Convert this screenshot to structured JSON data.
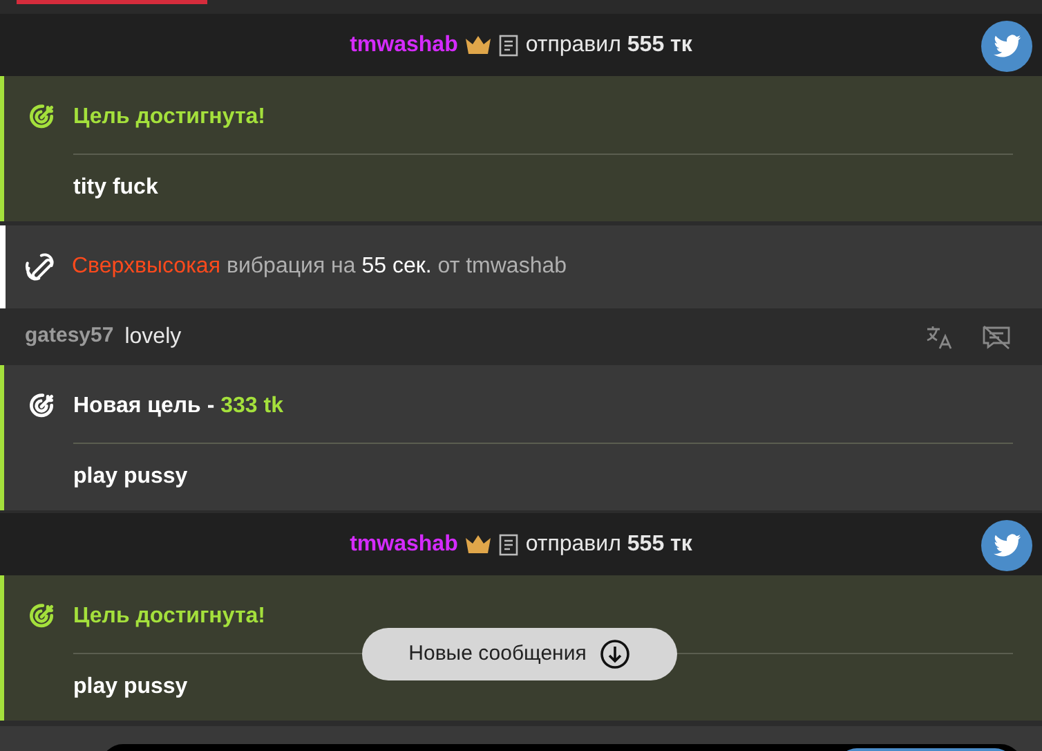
{
  "messages": [
    {
      "kind": "tip",
      "user": "tmwashab",
      "verb": "отправил",
      "amount": "555 тк"
    },
    {
      "kind": "goal_reached",
      "title": "Цель достигнута!",
      "text": "tity fuck"
    },
    {
      "kind": "vibration",
      "strength": "Сверхвысокая",
      "middle": "вибрация на",
      "duration": "55 сек.",
      "tail": "от tmwashab"
    },
    {
      "kind": "chat",
      "user": "gatesy57",
      "text": "lovely"
    },
    {
      "kind": "new_goal",
      "title": "Новая цель -",
      "amount": "333 tk",
      "text": "play pussy"
    },
    {
      "kind": "tip",
      "user": "tmwashab",
      "verb": "отправил",
      "amount": "555 тк"
    },
    {
      "kind": "goal_reached",
      "title": "Цель достигнута!",
      "text": "play pussy"
    }
  ],
  "new_messages_button": "Новые сообщения"
}
